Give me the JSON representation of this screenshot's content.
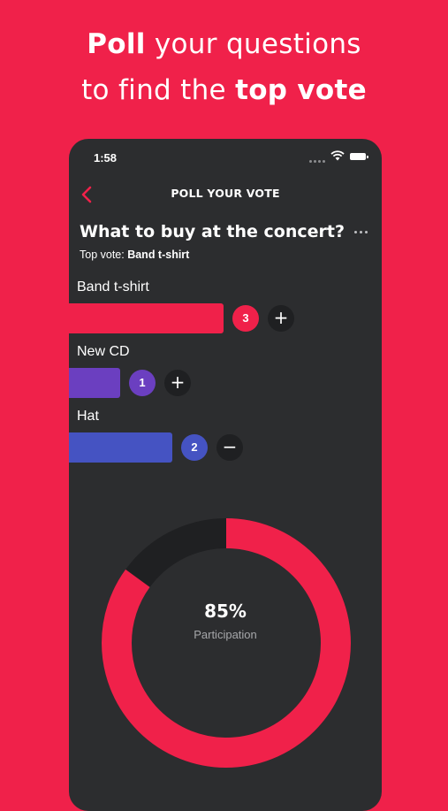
{
  "headline": {
    "line1_bold": "Poll",
    "line1_rest": " your questions",
    "line2_rest": "to find the ",
    "line2_bold": "top vote"
  },
  "status_bar": {
    "time": "1:58"
  },
  "nav": {
    "title": "POLL YOUR VOTE",
    "back_icon": "chevron-left-icon",
    "more_icon": "more-horizontal-icon"
  },
  "poll": {
    "question": "What to buy at the concert?",
    "top_vote_prefix": "Top vote: ",
    "top_vote_value": "Band t-shirt",
    "options": [
      {
        "label": "Band t-shirt",
        "votes": "3",
        "color": "#f0214a",
        "action": "+",
        "share": 0.5
      },
      {
        "label": "New CD",
        "votes": "1",
        "color": "#6b3fc0",
        "action": "+",
        "share": 0.1667
      },
      {
        "label": "Hat",
        "votes": "2",
        "color": "#4553c2",
        "action": "−",
        "share": 0.3333
      }
    ]
  },
  "participation": {
    "value": "85%",
    "label": "Participation",
    "fraction": 0.85
  },
  "colors": {
    "background": "#f0214a",
    "panel": "#2c2d2f",
    "accent": "#f0214a",
    "ring_track": "#1f2022"
  }
}
